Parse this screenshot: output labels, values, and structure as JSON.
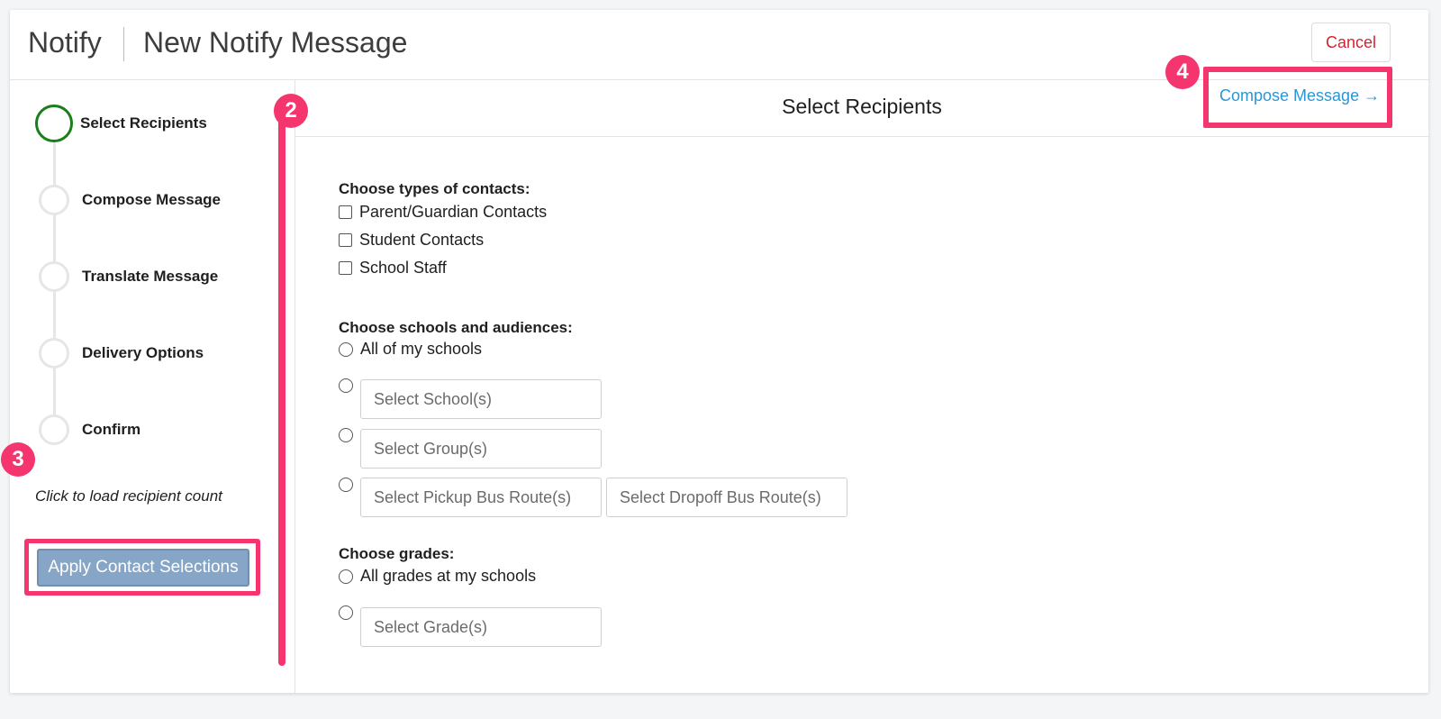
{
  "header": {
    "app_name": "Notify",
    "page_title": "New Notify Message",
    "cancel_label": "Cancel"
  },
  "steps": [
    {
      "label": "Select Recipients",
      "active": true
    },
    {
      "label": "Compose Message",
      "active": false
    },
    {
      "label": "Translate Message",
      "active": false
    },
    {
      "label": "Delivery Options",
      "active": false
    },
    {
      "label": "Confirm",
      "active": false
    }
  ],
  "sidebar": {
    "recipient_hint": "Click to load recipient count",
    "apply_label": "Apply Contact Selections"
  },
  "main": {
    "section_title": "Select Recipients",
    "next_link": "Compose Message →",
    "contacts": {
      "label": "Choose types of contacts:",
      "options": [
        "Parent/Guardian Contacts",
        "Student Contacts",
        "School Staff"
      ]
    },
    "schools": {
      "label": "Choose schools and audiences:",
      "all_option": "All of my schools",
      "school_placeholder": "Select School(s)",
      "group_placeholder": "Select Group(s)",
      "pickup_placeholder": "Select Pickup Bus Route(s)",
      "dropoff_placeholder": "Select Dropoff Bus Route(s)"
    },
    "grades": {
      "label": "Choose grades:",
      "all_option": "All grades at my schools",
      "grade_placeholder": "Select Grade(s)"
    }
  },
  "annotations": {
    "badge_2": "2",
    "badge_3": "3",
    "badge_4": "4"
  },
  "colors": {
    "accent_pink": "#f4356e",
    "active_step": "#1a7f1a",
    "link_blue": "#2a96d6",
    "cancel_red": "#d12631",
    "apply_button": "#86a5c7"
  }
}
